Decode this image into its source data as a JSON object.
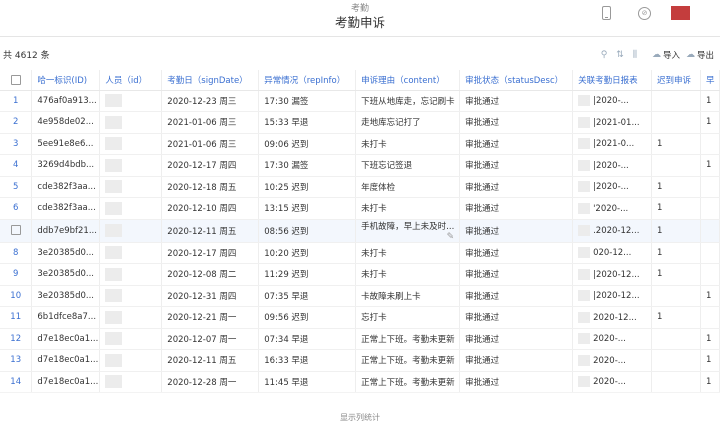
{
  "header": {
    "app_name": "考勤",
    "title": "考勤申诉",
    "icons": [
      "phone-icon",
      "time-zone-icon",
      "avatar"
    ],
    "avatar_color": "#c43d3d"
  },
  "toolbar": {
    "total": "共 4612 条",
    "import_label": "导入",
    "export_label": "导出"
  },
  "table": {
    "columns": [
      "哈一标识(ID)",
      "人员（id）",
      "考勤日（signDate）",
      "异常情况（repInfo）",
      "申诉理由（content）",
      "审批状态（statusDesc）",
      "关联考勤日报表",
      "迟到申诉",
      "早"
    ],
    "rows": [
      {
        "idx": "1",
        "id": "476af0a913...",
        "date": "2020-12-23 周三",
        "rep": "17:30 漏签",
        "content": "下班从地库走，忘记刷卡",
        "status": "审批通过",
        "report": "|2020-...",
        "late": "",
        "x": "1"
      },
      {
        "idx": "2",
        "id": "4e958de02...",
        "date": "2021-01-06 周三",
        "rep": "15:33 早退",
        "content": "走地库忘记打了",
        "status": "审批通过",
        "report": "|2021-01...",
        "late": "",
        "x": "1"
      },
      {
        "idx": "3",
        "id": "5ee91e8e6...",
        "date": "2021-01-06 周三",
        "rep": "09:06 迟到",
        "content": "未打卡",
        "status": "审批通过",
        "report": "|2021-0...",
        "late": "1",
        "x": ""
      },
      {
        "idx": "4",
        "id": "3269d4bdb...",
        "date": "2020-12-17 周四",
        "rep": "17:30 漏签",
        "content": "下班忘记签退",
        "status": "审批通过",
        "report": "|2020-...",
        "late": "",
        "x": "1"
      },
      {
        "idx": "5",
        "id": "cde382f3aa...",
        "date": "2020-12-18 周五",
        "rep": "10:25 迟到",
        "content": "年度体检",
        "status": "审批通过",
        "report": "|2020-...",
        "late": "1",
        "x": ""
      },
      {
        "idx": "6",
        "id": "cde382f3aa...",
        "date": "2020-12-10 周四",
        "rep": "13:15 迟到",
        "content": "未打卡",
        "status": "审批通过",
        "report": "'2020-...",
        "late": "1",
        "x": ""
      },
      {
        "idx": "",
        "id": "ddb7e9bf21...",
        "date": "2020-12-11 周五",
        "rep": "08:56 迟到",
        "content": "手机故障，早上未及时...",
        "status": "审批通过",
        "report": ".2020-12...",
        "late": "1",
        "x": ""
      },
      {
        "idx": "8",
        "id": "3e20385d0...",
        "date": "2020-12-17 周四",
        "rep": "10:20 迟到",
        "content": "未打卡",
        "status": "审批通过",
        "report": "020-12...",
        "late": "1",
        "x": ""
      },
      {
        "idx": "9",
        "id": "3e20385d0...",
        "date": "2020-12-08 周二",
        "rep": "11:29 迟到",
        "content": "未打卡",
        "status": "审批通过",
        "report": "|2020-12...",
        "late": "1",
        "x": ""
      },
      {
        "idx": "10",
        "id": "3e20385d0...",
        "date": "2020-12-31 周四",
        "rep": "07:35 早退",
        "content": "卡故障未刷上卡",
        "status": "审批通过",
        "report": "|2020-12...",
        "late": "",
        "x": "1"
      },
      {
        "idx": "11",
        "id": "6b1dfce8a7...",
        "date": "2020-12-21 周一",
        "rep": "09:56 迟到",
        "content": "忘打卡",
        "status": "审批通过",
        "report": "2020-12...",
        "late": "1",
        "x": ""
      },
      {
        "idx": "12",
        "id": "d7e18ec0a1...",
        "date": "2020-12-07 周一",
        "rep": "07:34 早退",
        "content": "正常上下班。考勤未更新",
        "status": "审批通过",
        "report": "2020-...",
        "late": "",
        "x": "1"
      },
      {
        "idx": "13",
        "id": "d7e18ec0a1...",
        "date": "2020-12-11 周五",
        "rep": "16:33 早退",
        "content": "正常上下班。考勤未更新",
        "status": "审批通过",
        "report": "2020-...",
        "late": "",
        "x": "1"
      },
      {
        "idx": "14",
        "id": "d7e18ec0a1...",
        "date": "2020-12-28 周一",
        "rep": "11:45 早退",
        "content": "正常上下班。考勤未更新",
        "status": "审批通过",
        "report": "2020-...",
        "late": "",
        "x": "1"
      }
    ]
  },
  "footer": {
    "label": "显示列统计"
  }
}
